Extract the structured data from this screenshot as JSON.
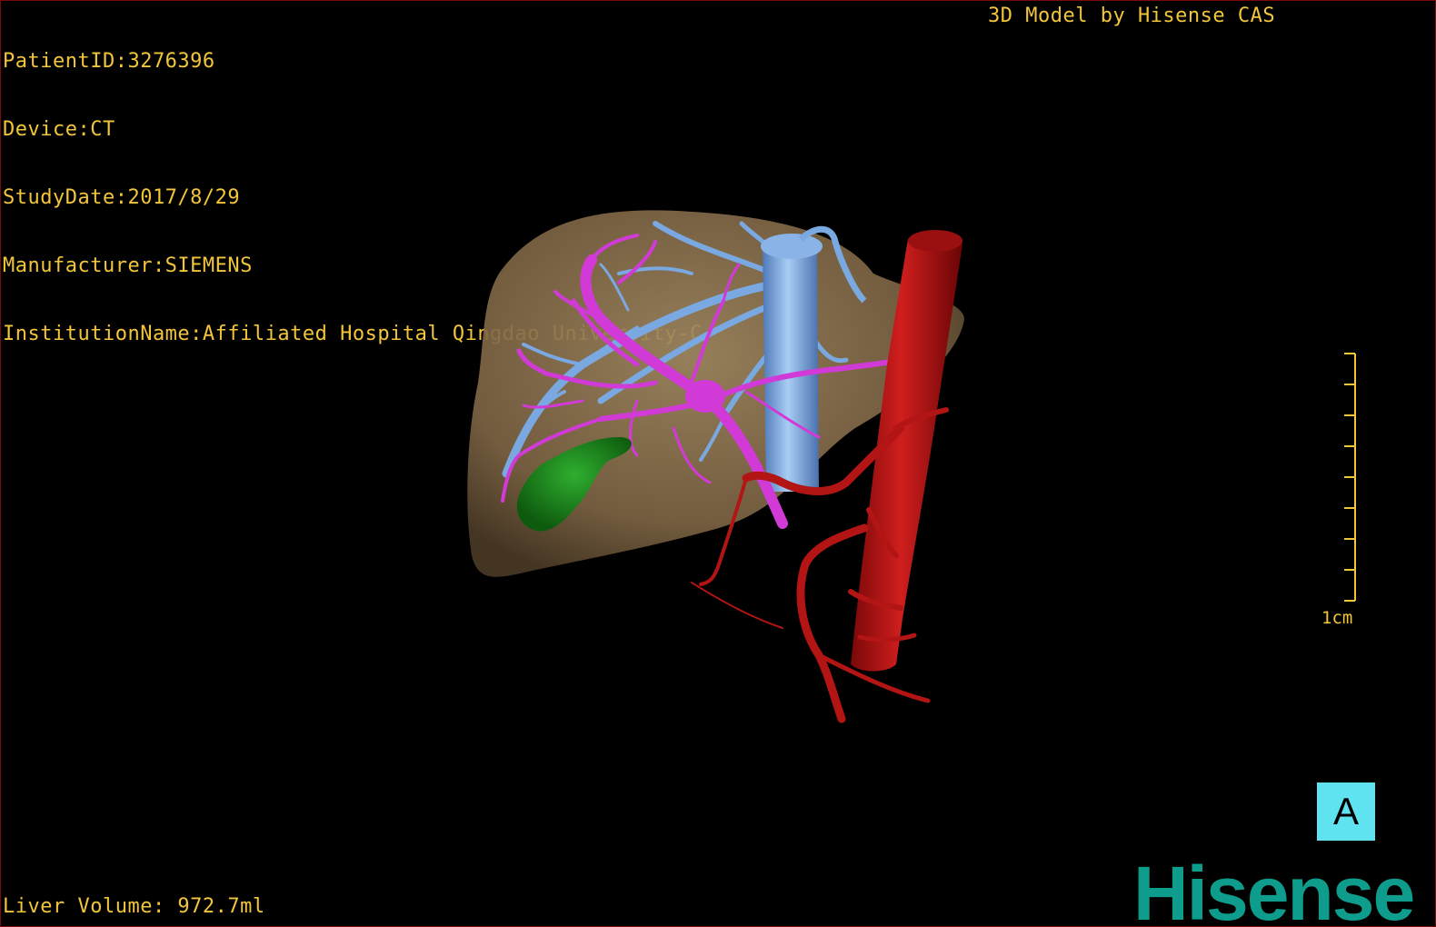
{
  "header": {
    "patient_id": "PatientID:3276396",
    "device": "Device:CT",
    "study_date": "StudyDate:2017/8/29",
    "manufacturer": "Manufacturer:SIEMENS",
    "institution": "InstitutionName:Affiliated Hospital Qingdao University-C",
    "model_credit": "3D Model by Hisense CAS"
  },
  "footer": {
    "liver_volume": "Liver Volume: 972.7ml"
  },
  "scale_bar": {
    "label": "1cm",
    "tick_count": 9
  },
  "view_orientation": {
    "label": "A"
  },
  "brand": {
    "logo_text": "Hisense",
    "color": "#0e9c8c"
  },
  "colors": {
    "overlay_text": "#f2c53a",
    "liver": "#8f7550",
    "hepatic_vein": "#7aa8e0",
    "portal_vein": "#d23ad8",
    "gallbladder": "#1f8a1f",
    "aorta": "#b31414",
    "view_label_bg": "#5fe3f0"
  },
  "model_structures": [
    "liver-parenchyma",
    "hepatic-vein-tree",
    "portal-vein-tree",
    "gallbladder",
    "aorta",
    "hepatic-artery"
  ]
}
